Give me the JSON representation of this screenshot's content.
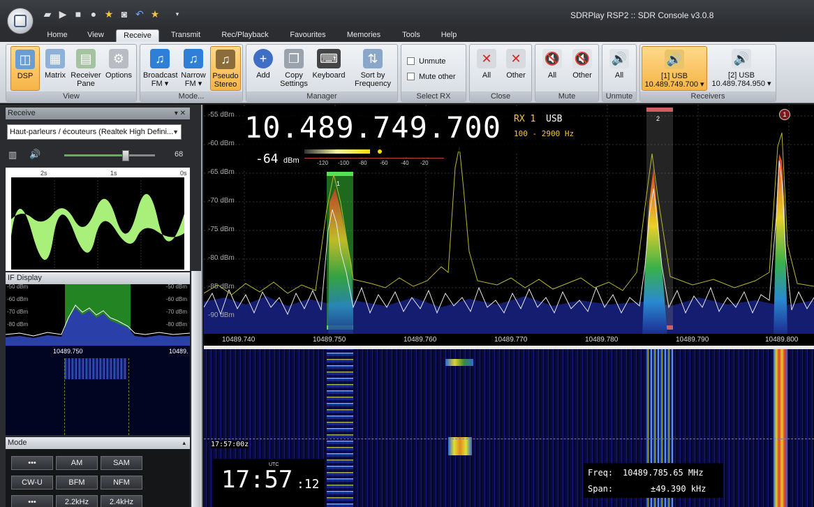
{
  "app": {
    "title": "SDRPlay RSP2 :: SDR Console v3.0.8"
  },
  "quick_access": [
    "folder-icon",
    "play-icon",
    "stop-icon",
    "record-icon",
    "favorite-star-icon",
    "camera-icon",
    "undo-icon",
    "star-icon",
    "dropdown-arrow-icon"
  ],
  "tabs": [
    {
      "label": "Home"
    },
    {
      "label": "View"
    },
    {
      "label": "Receive",
      "active": true
    },
    {
      "label": "Transmit"
    },
    {
      "label": "Rec/Playback"
    },
    {
      "label": "Favourites"
    },
    {
      "label": "Memories"
    },
    {
      "label": "Tools"
    },
    {
      "label": "Help"
    }
  ],
  "ribbon": {
    "view": {
      "title": "View",
      "dsp": "DSP",
      "matrix": "Matrix",
      "receiver_pane_1": "Receiver",
      "receiver_pane_2": "Pane",
      "options": "Options"
    },
    "mode": {
      "title": "Mode...",
      "broadcast_1": "Broadcast",
      "broadcast_2": "FM ▾",
      "narrow_1": "Narrow",
      "narrow_2": "FM ▾",
      "pseudo_1": "Pseudo",
      "pseudo_2": "Stereo"
    },
    "manager": {
      "title": "Manager",
      "add": "Add",
      "copy_1": "Copy",
      "copy_2": "Settings",
      "keyboard": "Keyboard",
      "sort_1": "Sort by",
      "sort_2": "Frequency"
    },
    "select_rx": {
      "title": "Select RX",
      "unmute": "Unmute",
      "mute_other": "Mute other"
    },
    "close": {
      "title": "Close",
      "all": "All",
      "other": "Other"
    },
    "mute": {
      "title": "Mute",
      "all": "All",
      "other": "Other"
    },
    "unmute": {
      "title": "Unmute",
      "all": "All"
    },
    "receivers": {
      "title": "Receivers",
      "rx1_line1": "[1]  USB",
      "rx1_line2": "10.489.749.700 ▾",
      "rx2_line1": "[2]  USB",
      "rx2_line2": "10.489.784.950 ▾"
    }
  },
  "left": {
    "receive_title": "Receive",
    "device": "Haut-parleurs / écouteurs (Realtek High Defini...",
    "volume": "68",
    "volume_fraction": 0.68,
    "time_labels": [
      "2s",
      "1s",
      "0s"
    ],
    "if_title": "IF Display",
    "if_dbm": [
      "-50 dBm",
      "-60 dBm",
      "-70 dBm",
      "-80 dBm"
    ],
    "if_freq": "10489.750",
    "if_freq_right": "10489.",
    "mode_title": "Mode",
    "modes": [
      "•••",
      "AM",
      "SAM",
      "CW-U",
      "BFM",
      "NFM",
      "•••",
      "2.2kHz",
      "2.4kHz"
    ]
  },
  "spectrum": {
    "frequency": "10.489.749.700",
    "rx_label": "RX 1",
    "mode": "USB",
    "bandwidth": "100 - 2900 Hz",
    "signal": "-64",
    "signal_unit": "dBm",
    "meter_ticks": [
      "-120",
      "-100",
      "-80",
      "-60",
      "-40",
      "-20"
    ],
    "y_labels": [
      "-55 dBm",
      "-60 dBm",
      "-65 dBm",
      "-70 dBm",
      "-75 dBm",
      "-80 dBm",
      "-85 dBm",
      "-90 dBm"
    ],
    "x_labels": [
      "10489.740",
      "10489.750",
      "10489.760",
      "10489.770",
      "10489.780",
      "10489.790",
      "10489.800"
    ],
    "rx1_marker": "1",
    "rx2_marker": "2",
    "peak_marker": "1"
  },
  "waterfall": {
    "timestamp": "17:57:00z",
    "clock_hm": "17:57",
    "clock_s": ":12",
    "clock_utc": "UTC",
    "freq_label": "Freq:",
    "freq_value": "10489.785.65 MHz",
    "span_label": "Span:",
    "span_value": "±49.390 kHz"
  }
}
